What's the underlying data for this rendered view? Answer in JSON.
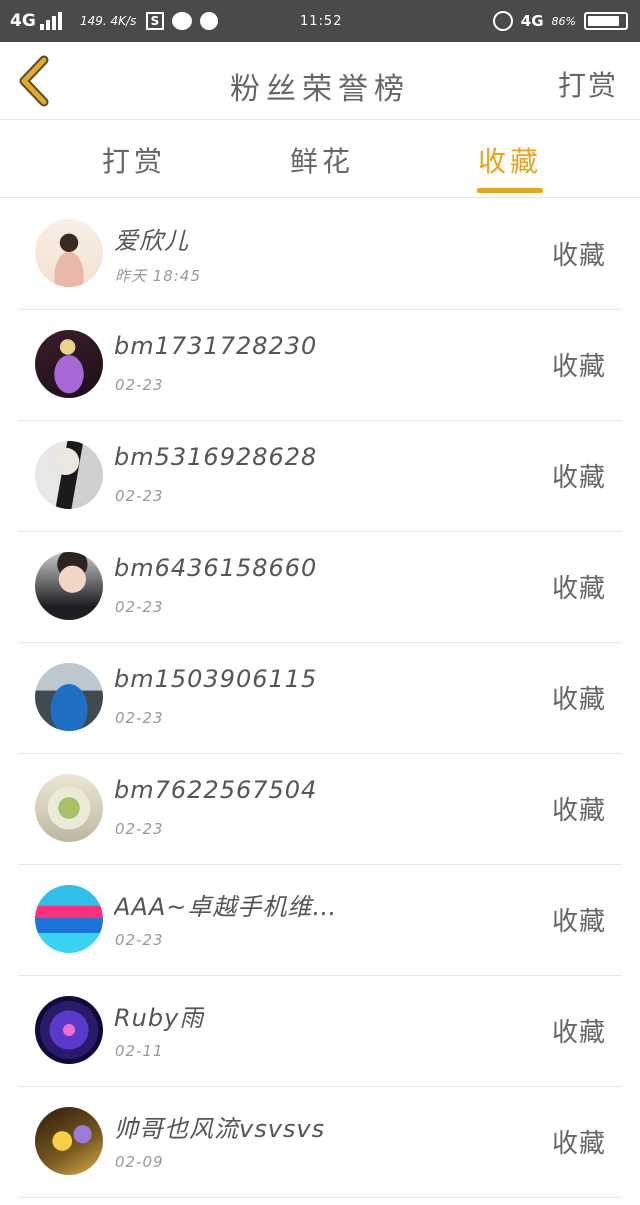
{
  "status_bar": {
    "network": "4G",
    "speed": "149. 4K/s",
    "s_icon": "S",
    "time": "11:52",
    "network_right": "4G",
    "battery": "86%",
    "battery_level": 0.86,
    "icons": [
      "signal-icon",
      "s-app-icon",
      "wechat-icon",
      "ball-app-icon",
      "alarm-icon",
      "battery-icon"
    ]
  },
  "header": {
    "title": "粉丝荣誉榜",
    "right_label": "打赏",
    "back_icon": "chevron-left-icon"
  },
  "tabs": [
    {
      "label": "打赏",
      "active": false
    },
    {
      "label": "鲜花",
      "active": false
    },
    {
      "label": "收藏",
      "active": true
    }
  ],
  "accent_color": "#e6a521",
  "fans": [
    {
      "name": "爱欣儿",
      "date": "昨天 18:45",
      "action": "收藏"
    },
    {
      "name": "bm1731728230",
      "date": "02-23",
      "action": "收藏"
    },
    {
      "name": "bm5316928628",
      "date": "02-23",
      "action": "收藏"
    },
    {
      "name": "bm6436158660",
      "date": "02-23",
      "action": "收藏"
    },
    {
      "name": "bm1503906115",
      "date": "02-23",
      "action": "收藏"
    },
    {
      "name": "bm7622567504",
      "date": "02-23",
      "action": "收藏"
    },
    {
      "name": "AAA~卓越手机维…",
      "date": "02-23",
      "action": "收藏"
    },
    {
      "name": "Ruby雨",
      "date": "02-11",
      "action": "收藏"
    },
    {
      "name": "帅哥也风流vsvsvs",
      "date": "02-09",
      "action": "收藏"
    }
  ]
}
